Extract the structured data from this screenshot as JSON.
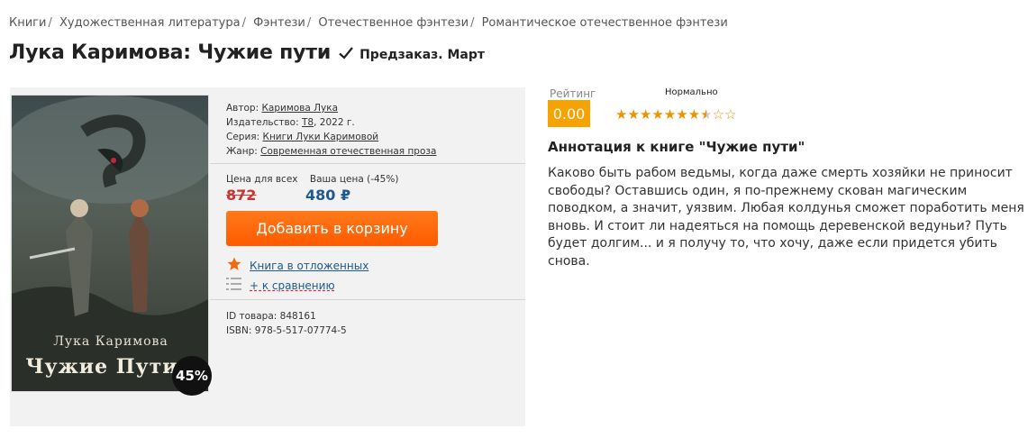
{
  "breadcrumb": [
    {
      "label": "Книги"
    },
    {
      "label": "Художественная литература"
    },
    {
      "label": "Фэнтези"
    },
    {
      "label": "Отечественное фэнтези"
    },
    {
      "label": "Романтическое отечественное фэнтези"
    }
  ],
  "breadcrumb_separator": "/",
  "product": {
    "title": "Лука Каримова: Чужие пути",
    "status": "Предзаказ. Март",
    "cover": {
      "author_text": "Лука Каримова",
      "title_text": "Чужие Пути",
      "discount_badge": "45%"
    },
    "meta": {
      "author_label": "Автор:",
      "author": "Каримова Лука",
      "publisher_label": "Издательство:",
      "publisher": "Т8",
      "year": ", 2022 г.",
      "series_label": "Серия:",
      "series": "Книги Луки Каримовой",
      "genre_label": "Жанр:",
      "genre": "Современная отечественная проза"
    },
    "price": {
      "regular_label": "Цена для всех",
      "your_label": "Ваша цена (-45%)",
      "old_price": "872",
      "new_price": "480 ₽"
    },
    "add_to_cart_label": "Добавить в корзину",
    "wishlist_label": "Книга в отложенных",
    "compare_label": "+ к сравнению",
    "id_label": "ID товара:",
    "id": "848161",
    "isbn_label": "ISBN:",
    "isbn": "978-5-517-07774-5"
  },
  "rating": {
    "label": "Рейтинг",
    "value": "0.00",
    "word": "Нормально",
    "stars_total": 10,
    "stars_filled": 7.5
  },
  "annotation": {
    "title": "Аннотация к книге \"Чужие пути\"",
    "text": "Каково быть рабом ведьмы, когда даже смерть хозяйки не приносит свободы? Оставшись один, я по-прежнему скован магическим поводком, а значит, уязвим. Любая колдунья сможет поработить меня вновь. И стоит ли надеяться на помощь деревенской ведуньи? Путь будет долгим... и я получу то, что хочу, даже если придется убить снова."
  },
  "colors": {
    "accent_orange": "#ff6a00",
    "rating_yellow": "#f4a300",
    "price_blue": "#1e5a8c",
    "old_price_red": "#c33",
    "star_orange": "#f29100"
  },
  "icons": {
    "status": "checkmark-icon",
    "wishlist": "star-icon",
    "compare": "list-icon"
  }
}
